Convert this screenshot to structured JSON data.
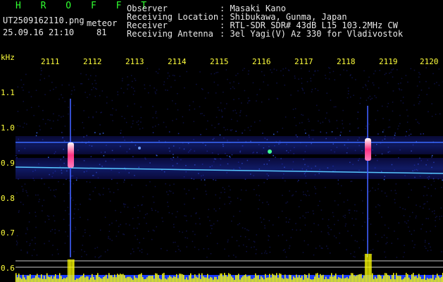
{
  "header": {
    "app_title": "H R O F F T",
    "filename": "UT2509162110.png",
    "meteor_label": "meteor",
    "datetime": "25.09.16 21:10",
    "count": "81"
  },
  "info": [
    {
      "label": "Observer",
      "value": ": Masaki Kano"
    },
    {
      "label": "Receiving Location",
      "value": ": Shibukawa, Gunma, Japan"
    },
    {
      "label": "Receiver",
      "value": ": RTL-SDR SDR# 43dB L15 103.2MHz CW"
    },
    {
      "label": "Receiving Antenna",
      "value": ": 3el Yagi(V) Az 330 for Vladivostok"
    }
  ],
  "axis": {
    "unit": "kHz",
    "y_ticks": [
      "1.1",
      "1.0",
      "0.9",
      "0.8",
      "0.7",
      "0.6"
    ],
    "x_ticks": [
      "2111",
      "2112",
      "2113",
      "2114",
      "2115",
      "2116",
      "2117",
      "2118",
      "2119",
      "2120"
    ]
  },
  "colors": {
    "background": "#000000",
    "text": "#e8e8e8",
    "axis_labels": "#ffff3c",
    "title": "#30ff30",
    "signal_band": "#2040ff",
    "meteor_echo": "#ff3080"
  }
}
